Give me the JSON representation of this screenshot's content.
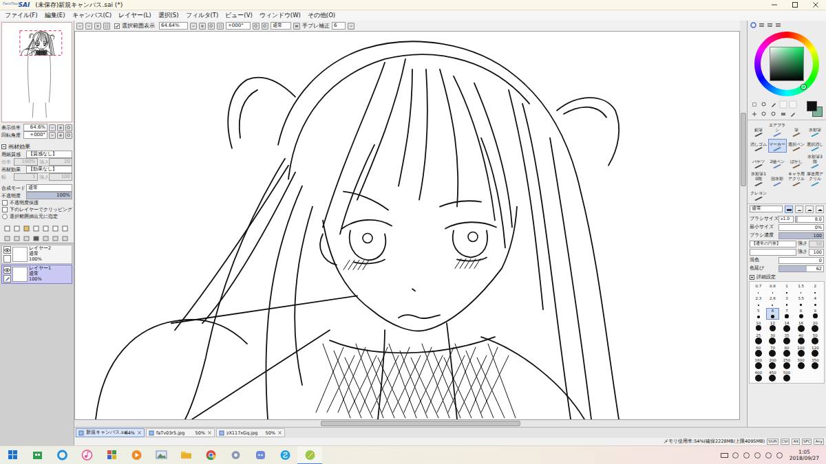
{
  "window": {
    "logo_small": "PaintTool",
    "logo": "SAI",
    "title": "(未保存)新規キャンバス.sai (*)"
  },
  "menu": [
    "ファイル(F)",
    "編集(E)",
    "キャンバス(C)",
    "レイヤー(L)",
    "選択(S)",
    "フィルタ(T)",
    "ビュー(V)",
    "ウィンドウ(W)",
    "その他(O)"
  ],
  "toolbar": {
    "show_selection": {
      "label": "選択範囲表示",
      "checked": true
    },
    "zoom": "64.64%",
    "rotation": "+000°",
    "blend_mode": "通常",
    "stabilizer_label": "手ブレ補正",
    "stabilizer": "6"
  },
  "navigator": {
    "rows": [
      {
        "label": "表示倍率",
        "value": "64.6%"
      },
      {
        "label": "回転角度",
        "value": "+000°"
      }
    ]
  },
  "material_effects": {
    "title": "画材効果",
    "expanded": true,
    "rows": [
      {
        "kind": "select",
        "label": "用紙質感",
        "value": "【質感なし】"
      },
      {
        "kind": "pair",
        "fields": [
          {
            "label": "倍率",
            "value": "100%",
            "disabled": true
          },
          {
            "label": "強さ",
            "value": "20",
            "disabled": true
          }
        ]
      },
      {
        "kind": "select",
        "label": "画材効果",
        "value": "【効果なし】"
      },
      {
        "kind": "pair",
        "fields": [
          {
            "label": "幅",
            "value": "1",
            "disabled": true
          },
          {
            "label": "強さ",
            "value": "100",
            "disabled": true
          }
        ]
      }
    ]
  },
  "layer_properties": {
    "blend_label": "合成モード",
    "blend": "通常",
    "opacity_label": "不透明度",
    "opacity": "100%",
    "opacity_level": 1,
    "options": [
      {
        "kind": "checkbox",
        "label": "不透明度保護",
        "checked": false
      },
      {
        "kind": "checkbox",
        "label": "下のレイヤーでクリッピング",
        "checked": false
      },
      {
        "kind": "radio",
        "label": "選択範囲抽出元に指定",
        "checked": false
      }
    ]
  },
  "layers": [
    {
      "name": "レイヤー2",
      "mode": "通常",
      "opacity": "100%",
      "visible": true,
      "drawing_target": false,
      "selected": false
    },
    {
      "name": "レイヤー1",
      "mode": "通常",
      "opacity": "100%",
      "visible": true,
      "drawing_target": true,
      "selected": true
    }
  ],
  "canvas_scroll": {
    "horizontal": {
      "start": 0.37,
      "size": 0.3
    },
    "vertical": {
      "start": 0.24,
      "size": 0.19
    }
  },
  "canvas_tabs": [
    {
      "name": "新規キャンバス.sai",
      "zoom": "64%",
      "selected": true
    },
    {
      "name": "faTv03r5.jpg",
      "zoom": "50%",
      "selected": false
    },
    {
      "name": "zX117xGq.jpg",
      "zoom": "50%",
      "selected": false
    }
  ],
  "status": {
    "memory": "メモリ使用率:54%(確保2228MB/上限4095MB)",
    "keys": [
      "Shift",
      "Ctrl",
      "Alt",
      "SPC",
      "Any"
    ]
  },
  "color": {
    "hue_level": 0.4,
    "swatches": [
      {
        "color": "#111111",
        "selected": true
      },
      {
        "color": "#7bb597",
        "selected": false
      }
    ]
  },
  "brushes": [
    {
      "label": "鉛筆",
      "selected": false
    },
    {
      "label": "エアブラシ",
      "selected": false
    },
    {
      "label": "筆",
      "selected": false
    },
    {
      "label": "水彩筆",
      "selected": false
    },
    {
      "label": "消しゴム",
      "selected": false
    },
    {
      "label": "マーカー",
      "selected": true
    },
    {
      "label": "選択ペン",
      "selected": false
    },
    {
      "label": "選択消し",
      "selected": false
    },
    {
      "label": "バケツ",
      "selected": false
    },
    {
      "label": "2値ペン",
      "selected": false
    },
    {
      "label": "ぼかし",
      "selected": false
    },
    {
      "label": "水彩筆3階",
      "selected": false
    },
    {
      "label": "水彩筆10階",
      "selected": false
    },
    {
      "label": "旧水彩",
      "selected": false
    },
    {
      "label": "キャラ用アクリル",
      "selected": false
    },
    {
      "label": "厚塗用アクリル",
      "selected": false
    },
    {
      "label": "クレヨン",
      "selected": false
    }
  ],
  "brush_settings": {
    "mode": "通常",
    "tip_shapes": [
      {
        "selected": true
      },
      {
        "selected": false
      },
      {
        "selected": false
      },
      {
        "selected": false
      }
    ],
    "sliders": [
      {
        "kind": "slider",
        "label": "ブラシサイズ",
        "prefix": "x1.0",
        "value": "8.0",
        "level": 0.08
      },
      {
        "kind": "slider",
        "label": "最小サイズ",
        "prefix": "",
        "value": "0%",
        "level": 0
      },
      {
        "kind": "slider",
        "label": "ブラシ濃度",
        "prefix": "",
        "value": "100",
        "level": 1
      },
      {
        "kind": "texture",
        "value": "【通常の円形】",
        "strength_label": "強さ",
        "strength": "50",
        "disabled": true
      },
      {
        "kind": "texture",
        "value": "",
        "strength_label": "強さ",
        "strength": "100",
        "disabled": false
      },
      {
        "kind": "slider",
        "label": "混色",
        "prefix": "",
        "value": "0",
        "level": 0
      },
      {
        "kind": "slider",
        "label": "色延び",
        "prefix": "",
        "value": "62",
        "level": 0.62
      }
    ],
    "details": {
      "label": "詳細設定",
      "expanded": false
    }
  },
  "brush_sizes": [
    {
      "size": "0.7",
      "selected": false
    },
    {
      "size": "0.8",
      "selected": false
    },
    {
      "size": "1",
      "selected": false
    },
    {
      "size": "1.5",
      "selected": false
    },
    {
      "size": "2",
      "selected": false
    },
    {
      "size": "2.3",
      "selected": false
    },
    {
      "size": "2.6",
      "selected": false
    },
    {
      "size": "3",
      "selected": false
    },
    {
      "size": "3.5",
      "selected": false
    },
    {
      "size": "4",
      "selected": false
    },
    {
      "size": "5",
      "selected": false
    },
    {
      "size": "6",
      "selected": true
    },
    {
      "size": "7",
      "selected": false
    },
    {
      "size": "8",
      "selected": false
    },
    {
      "size": "9",
      "selected": false
    },
    {
      "size": "10",
      "selected": false
    },
    {
      "size": "12",
      "selected": false
    },
    {
      "size": "14",
      "selected": false
    },
    {
      "size": "16",
      "selected": false
    },
    {
      "size": "20",
      "selected": false
    },
    {
      "size": "25",
      "selected": false
    },
    {
      "size": "30",
      "selected": false
    },
    {
      "size": "35",
      "selected": false
    },
    {
      "size": "40",
      "selected": false
    },
    {
      "size": "50",
      "selected": false
    },
    {
      "size": "60",
      "selected": false
    },
    {
      "size": "70",
      "selected": false
    },
    {
      "size": "80",
      "selected": false
    },
    {
      "size": "100",
      "selected": false
    },
    {
      "size": "120",
      "selected": false
    },
    {
      "size": "160",
      "selected": false
    },
    {
      "size": "200",
      "selected": false
    },
    {
      "size": "250",
      "selected": false
    },
    {
      "size": "300",
      "selected": false
    },
    {
      "size": "350",
      "selected": false
    },
    {
      "size": "400",
      "selected": false
    },
    {
      "size": "450",
      "selected": false
    },
    {
      "size": "500",
      "selected": false
    }
  ],
  "taskbar": {
    "time": "1:05",
    "date": "2018/09/27"
  }
}
